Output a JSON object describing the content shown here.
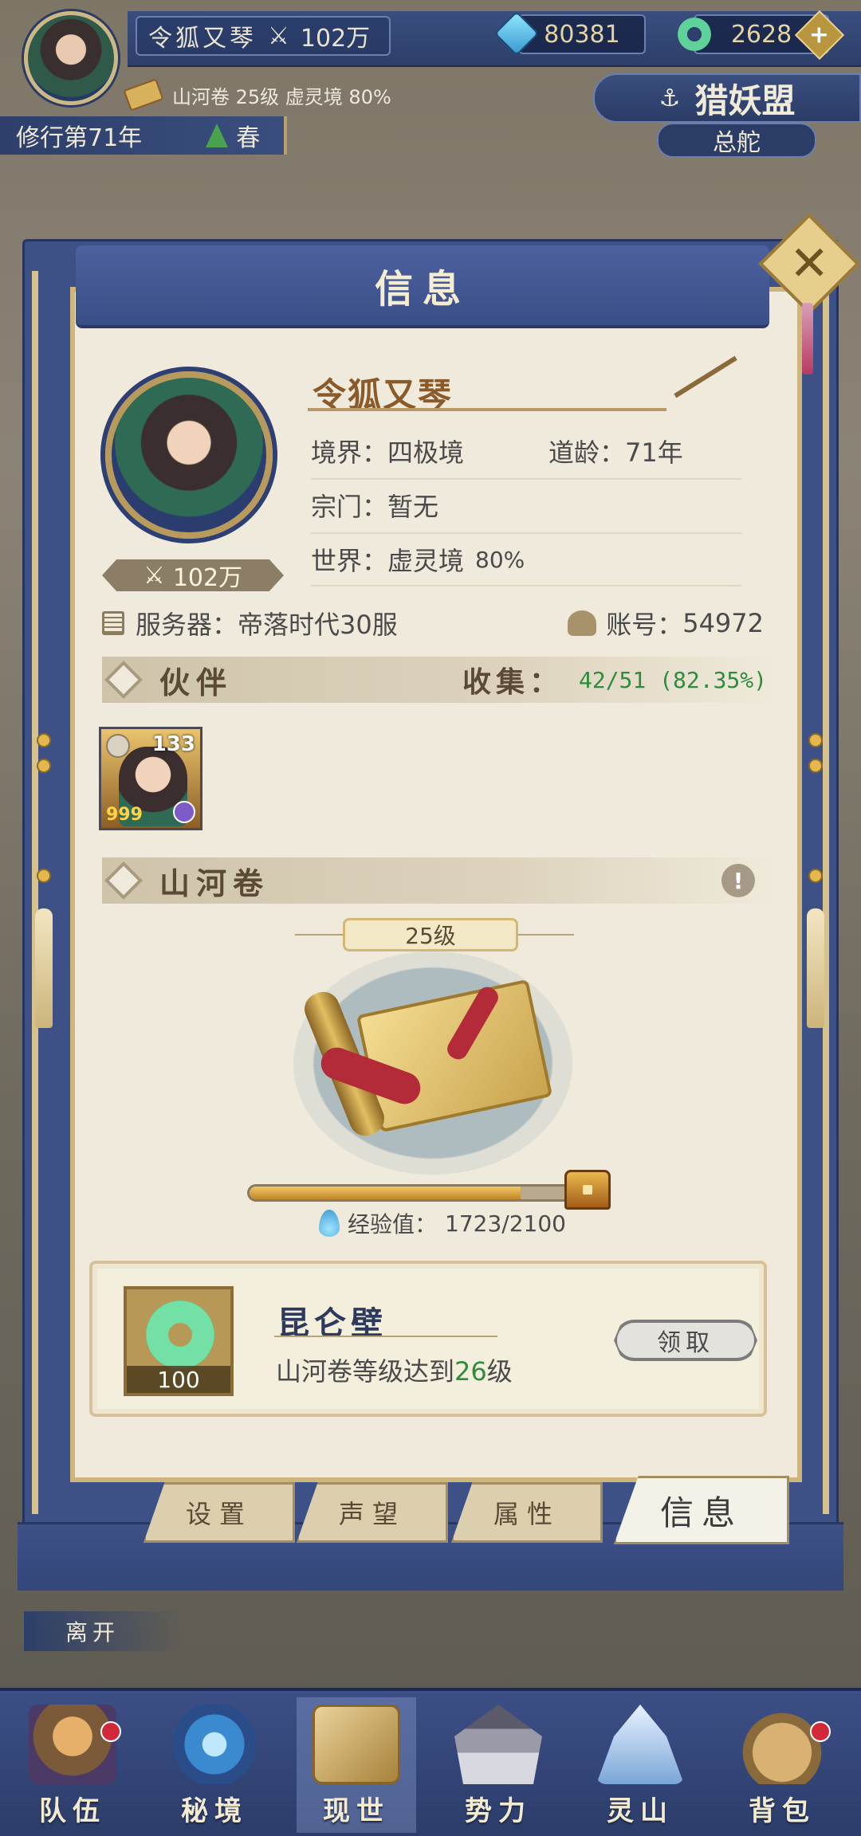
{
  "hud": {
    "player_name": "令狐又琴",
    "power": "102万",
    "crystals": "80381",
    "jade": "2628",
    "scroll_info": "山河卷 25级 虚灵境 80%",
    "cultivation_year": "修行第71年",
    "season": "春",
    "guild_name": "猎妖盟",
    "guild_sub": "总舵"
  },
  "panel": {
    "title": "信息",
    "close_icon": "✕"
  },
  "profile": {
    "name": "令狐又琴",
    "power": "102万",
    "realm_label": "境界：",
    "realm_value": "四极境",
    "age_label": "道龄：",
    "age_value": "71年",
    "sect_label": "宗门：",
    "sect_value": "暂无",
    "world_label": "世界：",
    "world_value": "虚灵境",
    "world_progress": "80%",
    "server_label": "服务器：",
    "server_value": "帝落时代30服",
    "account_label": "账号：",
    "account_value": "54972"
  },
  "partners": {
    "title": "伙伴",
    "collect_label": "收集：",
    "collect_value": "42/51 (82.35%)",
    "card": {
      "level": "133",
      "stars": "999"
    }
  },
  "scroll": {
    "title": "山河卷",
    "alert": "!",
    "level": "25级",
    "exp_label": "经验值：",
    "exp_value": "1723/2100",
    "exp_fraction": 0.8205
  },
  "reward": {
    "count": "100",
    "name": "昆仑壁",
    "desc_prefix": "山河卷等级达到",
    "desc_level": "26",
    "desc_suffix": "级",
    "claim_label": "领取"
  },
  "tabs": [
    {
      "label": "设置"
    },
    {
      "label": "声望"
    },
    {
      "label": "属性"
    },
    {
      "label": "信息"
    }
  ],
  "leave_label": "离开",
  "nav": [
    {
      "label": "队伍",
      "dot": true
    },
    {
      "label": "秘境",
      "dot": false
    },
    {
      "label": "现世",
      "dot": false
    },
    {
      "label": "势力",
      "dot": false
    },
    {
      "label": "灵山",
      "dot": false
    },
    {
      "label": "背包",
      "dot": true
    }
  ],
  "colors": {
    "panel_blue": "#3e5187",
    "paper": "#efeadb",
    "green_text": "#2e8c3c",
    "gold": "#cdb57b"
  }
}
